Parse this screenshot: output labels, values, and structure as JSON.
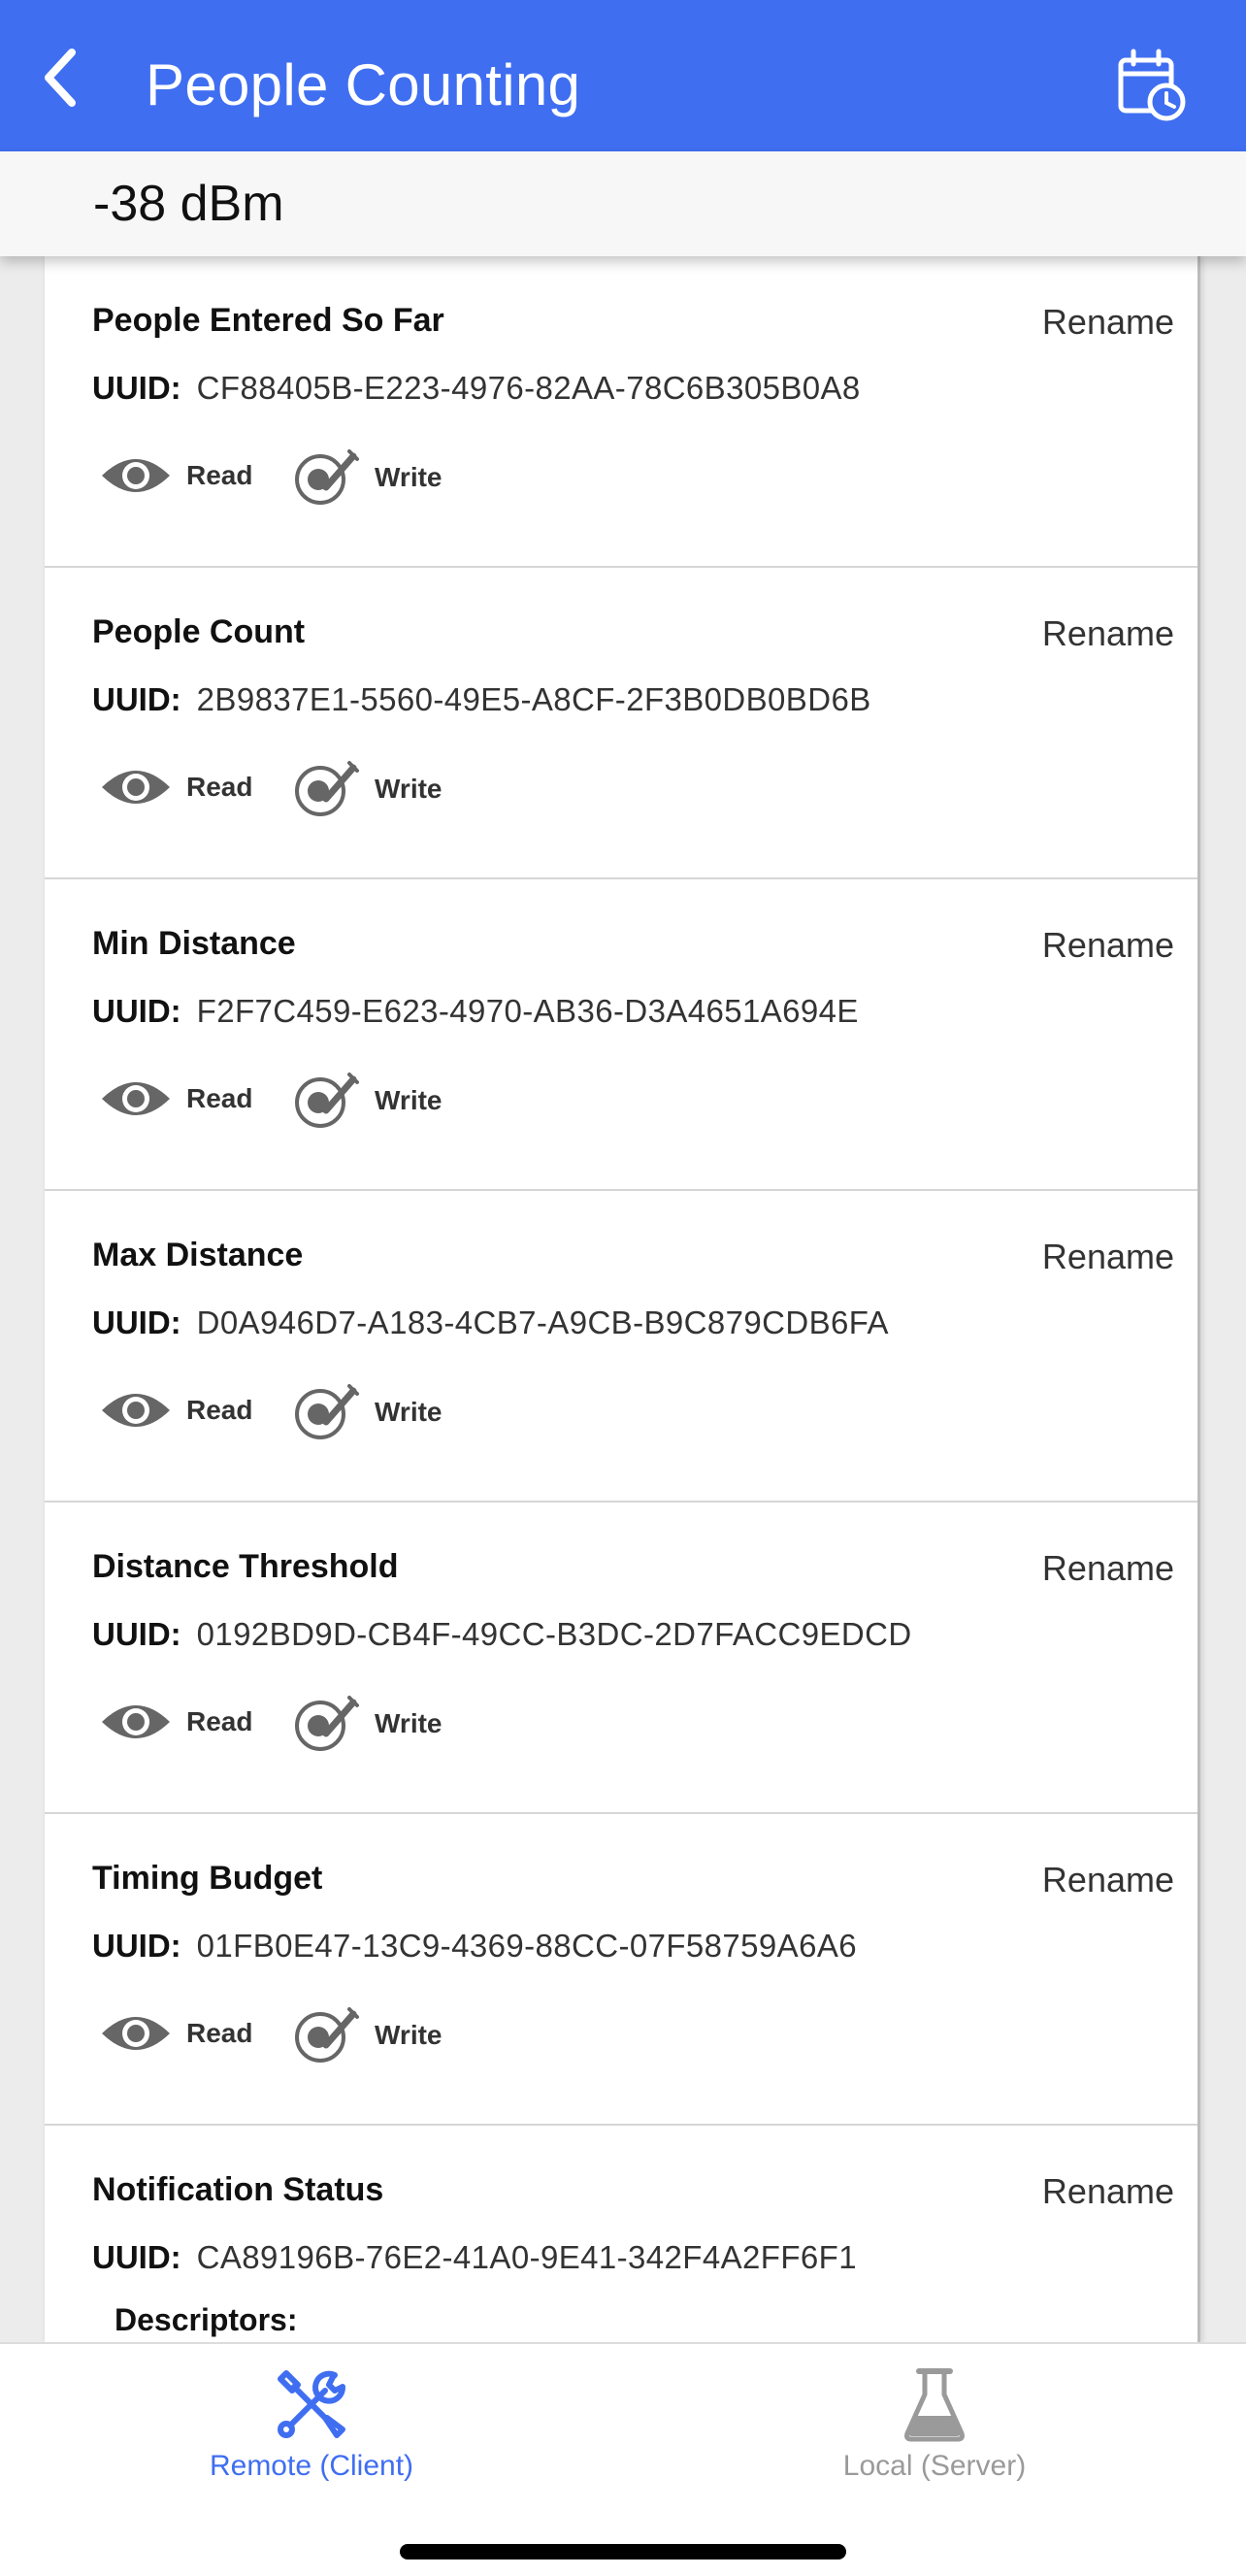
{
  "header": {
    "title": "People Counting"
  },
  "signal": {
    "rssi": "-38 dBm"
  },
  "labels": {
    "uuid": "UUID:",
    "rename": "Rename",
    "read": "Read",
    "write": "Write",
    "descriptors": "Descriptors:"
  },
  "characteristics": [
    {
      "name": "People Entered So Far",
      "uuid": "CF88405B-E223-4976-82AA-78C6B305B0A8"
    },
    {
      "name": "People Count",
      "uuid": "2B9837E1-5560-49E5-A8CF-2F3B0DB0BD6B"
    },
    {
      "name": "Min Distance",
      "uuid": "F2F7C459-E623-4970-AB36-D3A4651A694E"
    },
    {
      "name": "Max Distance",
      "uuid": "D0A946D7-A183-4CB7-A9CB-B9C879CDB6FA"
    },
    {
      "name": "Distance Threshold",
      "uuid": "0192BD9D-CB4F-49CC-B3DC-2D7FACC9EDCD"
    },
    {
      "name": "Timing Budget",
      "uuid": "01FB0E47-13C9-4369-88CC-07F58759A6A6"
    },
    {
      "name": "Notification Status",
      "uuid": "CA89196B-76E2-41A0-9E41-342F4A2FF6F1"
    }
  ],
  "bottom_nav": {
    "items": [
      {
        "label": "Remote (Client)",
        "icon": "tools-icon",
        "active": true
      },
      {
        "label": "Local (Server)",
        "icon": "flask-icon",
        "active": false
      }
    ]
  },
  "colors": {
    "primary": "#3f6ef1",
    "inactive": "#9a9a9a"
  }
}
